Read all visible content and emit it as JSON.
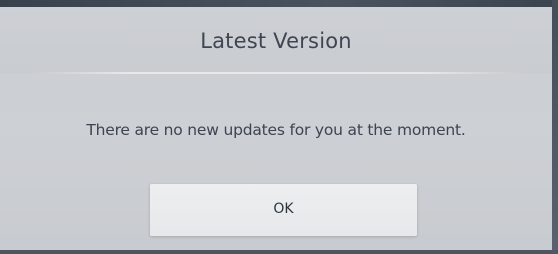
{
  "dialog": {
    "title": "Latest Version",
    "message": "There are no new updates for you at the moment.",
    "ok_label": "OK"
  },
  "colors": {
    "dialog_bg": "#cdd0d4",
    "text": "#3f4652",
    "button_bg": "#eceef0",
    "frame": "#4a5260"
  }
}
